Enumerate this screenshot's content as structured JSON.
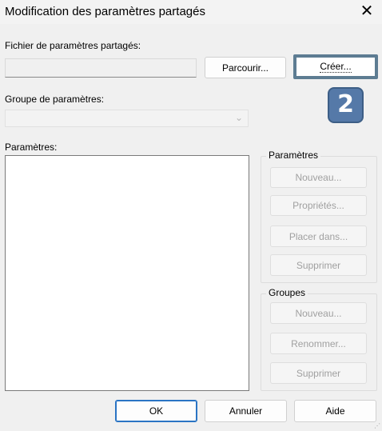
{
  "window": {
    "title": "Modification des paramètres partagés",
    "close_glyph": "✕"
  },
  "file": {
    "label": "Fichier de paramètres partagés:",
    "value": "",
    "browse_label": "Parcourir...",
    "create_label": "Créer..."
  },
  "annotation": {
    "badge": "2",
    "badge_color": "#5579a8"
  },
  "group_select": {
    "label": "Groupe de paramètres:",
    "value": ""
  },
  "parameters_list": {
    "label": "Paramètres:",
    "items": []
  },
  "parameters_group": {
    "title": "Paramètres",
    "new_label": "Nouveau...",
    "properties_label": "Propriétés...",
    "place_label": "Placer dans...",
    "delete_label": "Supprimer"
  },
  "groups_group": {
    "title": "Groupes",
    "new_label": "Nouveau...",
    "rename_label": "Renommer...",
    "delete_label": "Supprimer"
  },
  "footer": {
    "ok_label": "OK",
    "cancel_label": "Annuler",
    "help_label": "Aide"
  },
  "colors": {
    "highlight_border": "#5d7c92",
    "default_button_border": "#2a74c4"
  }
}
